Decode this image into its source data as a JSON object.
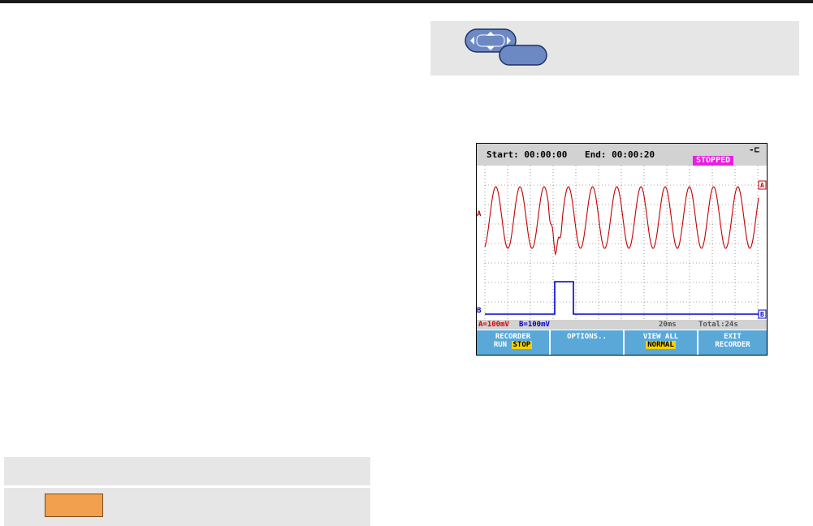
{
  "scope": {
    "start_label": "Start: 00:00:00",
    "end_label": "End:  00:00:20",
    "status": "STOPPED",
    "marker_a": "A",
    "marker_b": "B",
    "scale_a": "A=100mV",
    "scale_b": "B=100mV",
    "timebase": "20ms",
    "total": "Total:24s",
    "colors": {
      "trace_a": "#c40000",
      "trace_b": "#0000cc",
      "softkey_bg": "#5aa8d8",
      "status_bg": "#e81fe0",
      "highlight": "#f2d200"
    }
  },
  "softkeys": [
    {
      "line1": "RECORDER",
      "line2_pre": "RUN ",
      "line2_hl": "STOP"
    },
    {
      "line1": "",
      "line2_pre": "OPTIONS..",
      "line2_hl": ""
    },
    {
      "line1": "VIEW ALL",
      "line2_pre": "",
      "line2_hl": "NORMAL"
    },
    {
      "line1": "EXIT",
      "line2_pre": "RECORDER",
      "line2_hl": ""
    }
  ],
  "icons": {
    "nav": "arrow-keys-with-enter-icon",
    "key": "orange-function-key-icon",
    "plug": "power-plug-icon"
  }
}
